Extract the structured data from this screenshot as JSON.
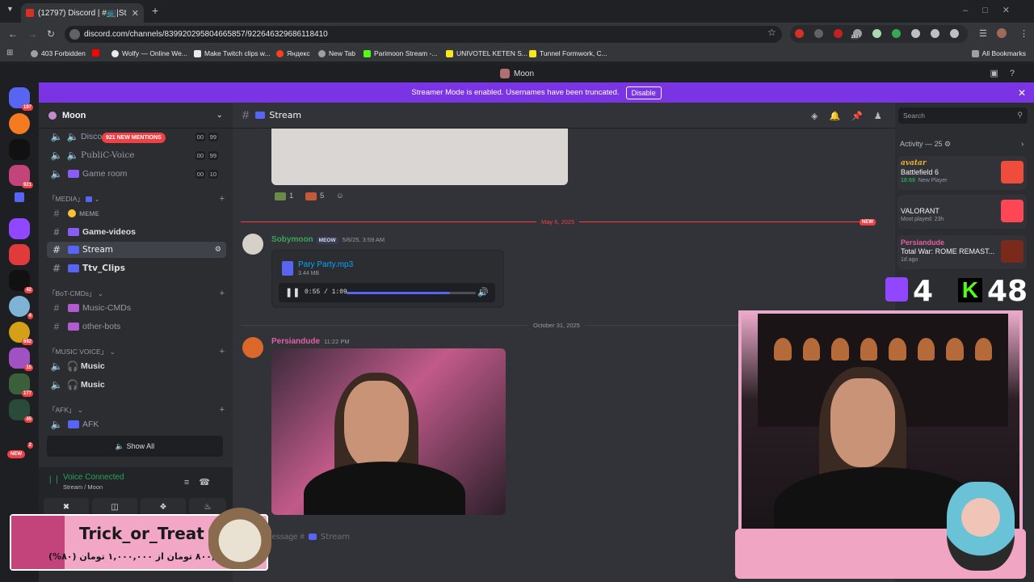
{
  "browser": {
    "tab_title": "(12797) Discord | #📺|St",
    "url": "discord.com/channels/839920295804665857/922646329686118410",
    "ext_badge": "260",
    "bookmarks": [
      "403 Forbidden",
      "Wolfy — Online We...",
      "Make Twitch clips w...",
      "Яндекс",
      "New Tab",
      "Parimoon Stream -...",
      "UNIVOTEL KETEN S...",
      "Tunnel Formwork, C..."
    ],
    "all_bookmarks": "All Bookmarks"
  },
  "app": {
    "title": "Moon"
  },
  "servers": {
    "badges": [
      "197",
      "921",
      "42",
      "4",
      "692",
      "15",
      "177",
      "45",
      "2"
    ],
    "new_label": "NEW"
  },
  "banner": {
    "text": "Streamer Mode is enabled. Usernames have been truncated.",
    "disable": "Disable"
  },
  "guild": {
    "name": "Moon",
    "mentions": "921 NEW MENTIONS",
    "voice1": {
      "name": "Disco",
      "c1": "00",
      "c2": "99"
    },
    "voice2": {
      "name": "PubliC-Voice",
      "c1": "00",
      "c2": "99"
    },
    "voice3": {
      "name": "Game room",
      "c1": "00",
      "c2": "10"
    },
    "cat_media": "「MEDIA」",
    "ch_meme": "ᴍᴇᴍᴇ",
    "ch_game": "Game-videos",
    "ch_stream": "Stream",
    "ch_ttv": "Ttv_Clips",
    "cat_bot": "「BoT-CMDs」",
    "ch_music_cmds": "Music-CMDs",
    "ch_other_bots": "other-bots",
    "cat_music": "「MUSIC VOICE」",
    "ch_music1": "Music",
    "ch_music2": "Music",
    "cat_afk": "「AFK」",
    "ch_afk": "AFK",
    "show_all": "Show All"
  },
  "voice": {
    "status": "Voice Connected",
    "location": "Stream / Moon"
  },
  "chat": {
    "channel": "Stream",
    "reaction1": "1",
    "reaction2": "5",
    "date1": "May 6, 2025",
    "new_tag": "NEW",
    "msg1": {
      "user": "Sobymoon",
      "tag": "MEOW",
      "time": "5/6/25, 3:59 AM",
      "file": "Pary Party.mp3",
      "size": "3.44 MB",
      "time_display": "0:55 / 1:09",
      "progress": 0.8
    },
    "date2": "October 31, 2025",
    "msg2": {
      "user": "Persiandude",
      "time": "11:22 PM"
    },
    "placeholder_prefix": "Message #",
    "placeholder_channel": "Stream"
  },
  "members": {
    "search": "Search",
    "activity": "Activity — 25",
    "acts": [
      {
        "user": "avatar",
        "game": "Battlefield 6",
        "time": "18:69",
        "status": "New Player"
      },
      {
        "user": "",
        "game": "VALORANT",
        "status": "Most played: 23h"
      },
      {
        "user": "Persiandude",
        "game": "Total War: ROME REMAST...",
        "status": "1d ago"
      }
    ]
  },
  "overlay": {
    "twitch_count": "4",
    "kick_count": "48",
    "trick_title": "Trick_or_Treat",
    "trick_text": "۸۰۰,۰۰۰ تومان از ۱,۰۰۰,۰۰۰ تومان (۸۰%)"
  }
}
